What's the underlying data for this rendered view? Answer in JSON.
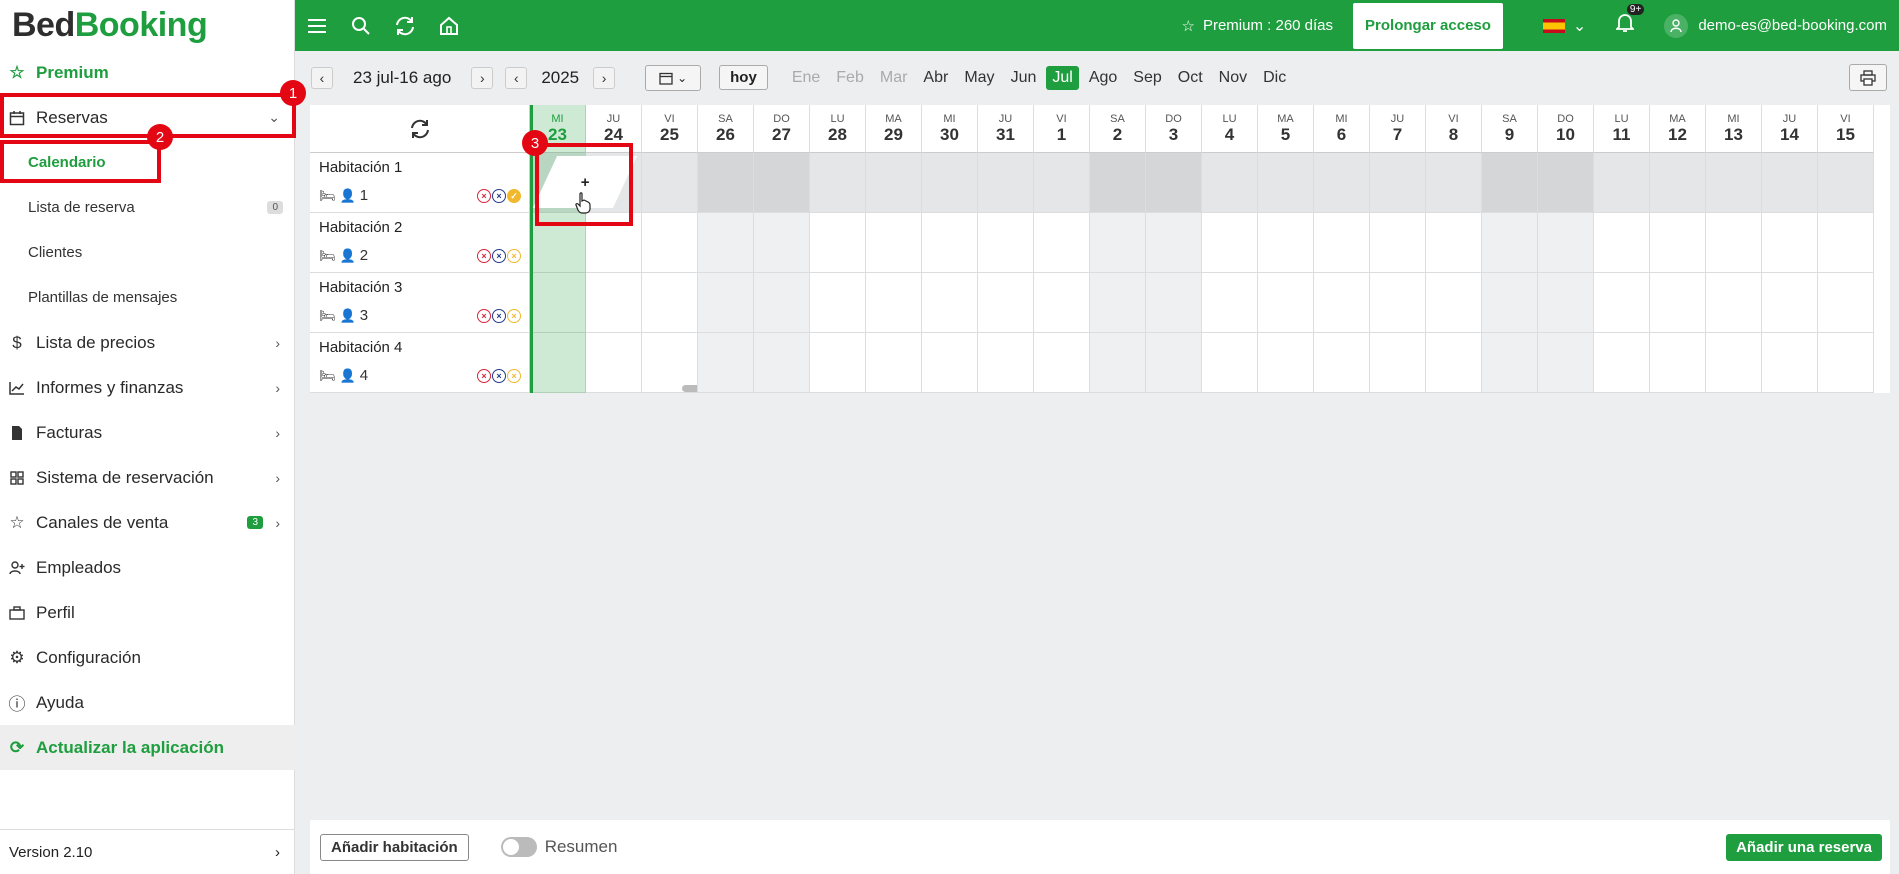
{
  "app": {
    "logo_left": "Bed",
    "logo_right": "Booking"
  },
  "sidebar": {
    "premium": "Premium",
    "reservas": "Reservas",
    "sub": [
      {
        "label": "Calendario"
      },
      {
        "label": "Lista de reserva",
        "badge": "0"
      },
      {
        "label": "Clientes"
      },
      {
        "label": "Plantillas de mensajes"
      }
    ],
    "items": [
      {
        "label": "Lista de precios"
      },
      {
        "label": "Informes y finanzas"
      },
      {
        "label": "Facturas"
      },
      {
        "label": "Sistema de reservación"
      },
      {
        "label": "Canales de venta",
        "badge": "3"
      },
      {
        "label": "Empleados"
      },
      {
        "label": "Perfil"
      },
      {
        "label": "Configuración"
      },
      {
        "label": "Ayuda"
      }
    ],
    "update": "Actualizar la aplicación",
    "version": "Version 2.10"
  },
  "topbar": {
    "premium_text": "Premium : 260 días",
    "extend": "Prolongar acceso",
    "notifications": "9+",
    "email": "demo-es@bed-booking.com"
  },
  "toolbar": {
    "period": "23 jul-16 ago",
    "year": "2025",
    "today": "hoy",
    "months": [
      "Ene",
      "Feb",
      "Mar",
      "Abr",
      "May",
      "Jun",
      "Jul",
      "Ago",
      "Sep",
      "Oct",
      "Nov",
      "Dic"
    ],
    "active_month": "Jul"
  },
  "calendar": {
    "days": [
      {
        "dn": "MI",
        "dd": "23"
      },
      {
        "dn": "JU",
        "dd": "24"
      },
      {
        "dn": "VI",
        "dd": "25"
      },
      {
        "dn": "SA",
        "dd": "26"
      },
      {
        "dn": "DO",
        "dd": "27"
      },
      {
        "dn": "LU",
        "dd": "28"
      },
      {
        "dn": "MA",
        "dd": "29"
      },
      {
        "dn": "MI",
        "dd": "30"
      },
      {
        "dn": "JU",
        "dd": "31"
      },
      {
        "dn": "VI",
        "dd": "1"
      },
      {
        "dn": "SA",
        "dd": "2"
      },
      {
        "dn": "DO",
        "dd": "3"
      },
      {
        "dn": "LU",
        "dd": "4"
      },
      {
        "dn": "MA",
        "dd": "5"
      },
      {
        "dn": "MI",
        "dd": "6"
      },
      {
        "dn": "JU",
        "dd": "7"
      },
      {
        "dn": "VI",
        "dd": "8"
      },
      {
        "dn": "SA",
        "dd": "9"
      },
      {
        "dn": "DO",
        "dd": "10"
      },
      {
        "dn": "LU",
        "dd": "11"
      },
      {
        "dn": "MA",
        "dd": "12"
      },
      {
        "dn": "MI",
        "dd": "13"
      },
      {
        "dn": "JU",
        "dd": "14"
      },
      {
        "dn": "VI",
        "dd": "15"
      }
    ],
    "rooms": [
      {
        "name": "Habitación 1",
        "capacity": "1"
      },
      {
        "name": "Habitación 2",
        "capacity": "2"
      },
      {
        "name": "Habitación 3",
        "capacity": "3"
      },
      {
        "name": "Habitación 4",
        "capacity": "4"
      }
    ],
    "new_res_symbol": "+"
  },
  "annotations": [
    "1",
    "2",
    "3"
  ],
  "footer": {
    "add_room": "Añadir habitación",
    "summary": "Resumen",
    "add_reservation": "Añadir una reserva"
  },
  "colors": {
    "brand": "#1e9e3e",
    "annotation": "#e30613"
  }
}
